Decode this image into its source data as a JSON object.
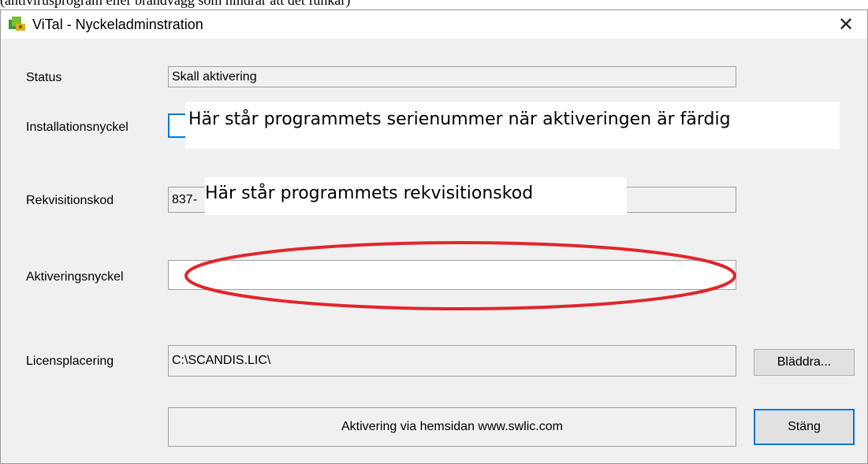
{
  "top_cut_text": "(antivirusprogram eller brandvägg som hindrar att det funkar)",
  "window": {
    "title": "ViTal - Nyckeladminstration",
    "close_glyph": "✕"
  },
  "status": {
    "label": "Status",
    "value": "Skall aktivering"
  },
  "installationsnyckel": {
    "label": "Installationsnyckel",
    "value": "",
    "overlay": "Här står programmets serienummer när aktiveringen är färdig"
  },
  "rekvisitionskod": {
    "label": "Rekvisitionskod",
    "value": "837-",
    "overlay": "Här står programmets rekvisitionskod"
  },
  "aktiveringsnyckel": {
    "label": "Aktiveringsnyckel",
    "value": ""
  },
  "licensplacering": {
    "label": "Licensplacering",
    "value": "C:\\SCANDIS.LIC\\"
  },
  "browse_button": "Bläddra...",
  "info_text": "Aktivering via hemsidan www.swlic.com",
  "close_button": "Stäng",
  "colors": {
    "annotation_ellipse": "#e0262b",
    "focus_border": "#0078d7"
  }
}
